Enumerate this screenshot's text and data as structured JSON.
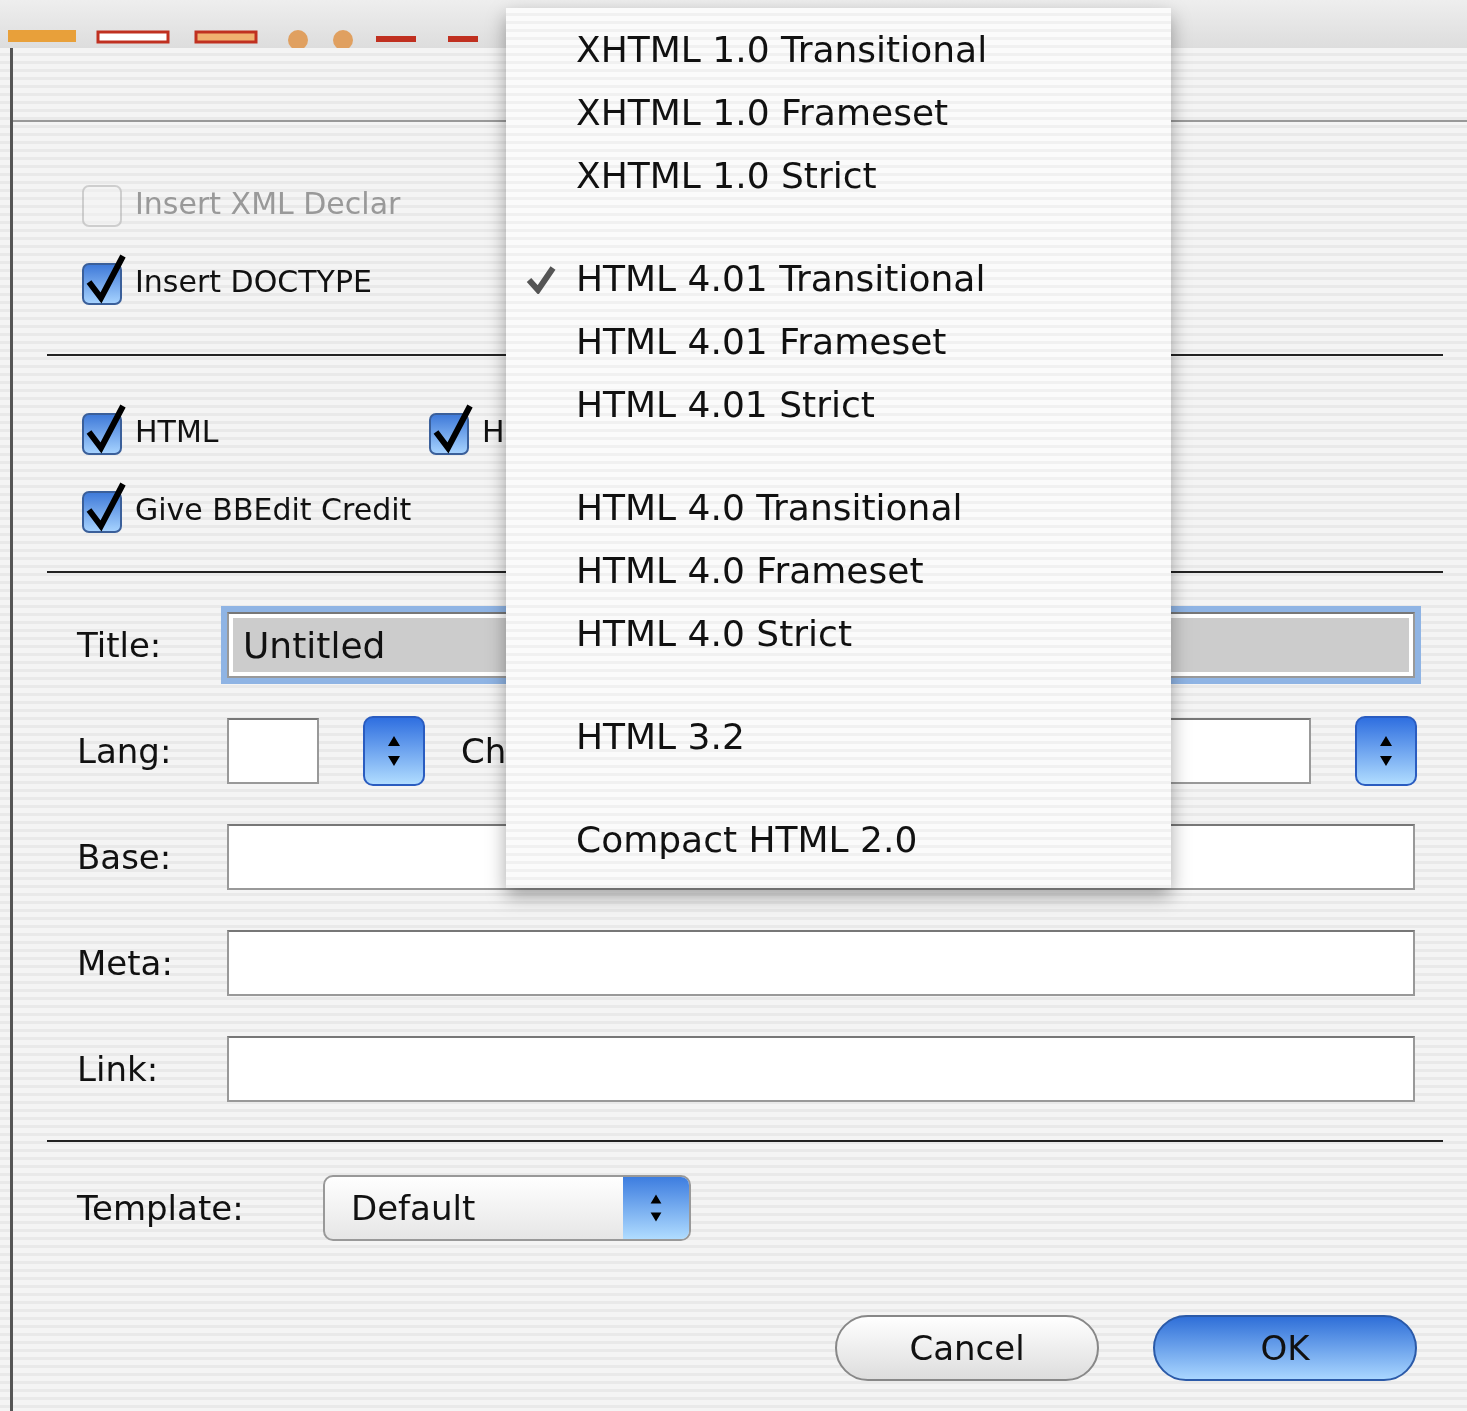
{
  "checkbox_rows": [
    [
      {
        "label": "Insert XML Declar",
        "checked": false,
        "disabled": true
      }
    ],
    [
      {
        "label": "Insert DOCTYPE",
        "checked": true,
        "disabled": false
      }
    ],
    [
      {
        "label": "HTML",
        "checked": true,
        "disabled": false
      },
      {
        "label": "H",
        "checked": true,
        "disabled": false
      }
    ],
    [
      {
        "label": "Give BBEdit Credit",
        "checked": true,
        "disabled": false
      }
    ]
  ],
  "title_field": {
    "label": "Title:",
    "value": "Untitled",
    "focused": true
  },
  "lang_row": {
    "label": "Lang:",
    "charset_label": "Ch"
  },
  "fields": [
    {
      "label": "Base:"
    },
    {
      "label": "Meta:"
    },
    {
      "label": "Link:"
    }
  ],
  "template": {
    "label": "Template:",
    "value": "Default"
  },
  "buttons": [
    {
      "label": "Cancel",
      "default": false
    },
    {
      "label": "OK",
      "default": true
    }
  ],
  "doctype_menu": [
    [
      {
        "label": "XHTML 1.0 Transitional",
        "selected": false
      },
      {
        "label": "XHTML 1.0 Frameset",
        "selected": false
      },
      {
        "label": "XHTML 1.0 Strict",
        "selected": false
      }
    ],
    [
      {
        "label": "HTML 4.01 Transitional",
        "selected": true
      },
      {
        "label": "HTML 4.01 Frameset",
        "selected": false
      },
      {
        "label": "HTML 4.01 Strict",
        "selected": false
      }
    ],
    [
      {
        "label": "HTML 4.0 Transitional",
        "selected": false
      },
      {
        "label": "HTML 4.0 Frameset",
        "selected": false
      },
      {
        "label": "HTML 4.0 Strict",
        "selected": false
      }
    ],
    [
      {
        "label": "HTML 3.2",
        "selected": false
      }
    ],
    [
      {
        "label": "Compact HTML 2.0",
        "selected": false
      }
    ]
  ]
}
